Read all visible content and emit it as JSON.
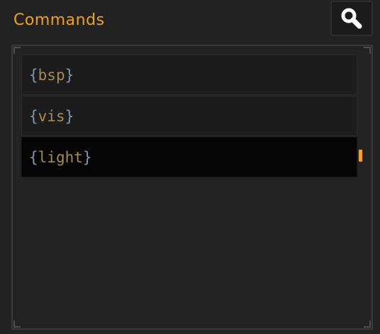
{
  "header": {
    "title": "Commands",
    "search_icon": "search-icon"
  },
  "commands": {
    "items": [
      {
        "open": "{",
        "name": "bsp",
        "close": "}"
      },
      {
        "open": "{",
        "name": "vis",
        "close": "}"
      },
      {
        "open": "{",
        "name": "light",
        "close": "}"
      }
    ],
    "selected_index": 2
  },
  "colors": {
    "accent": "#f2a21f",
    "brace": "#7f99b5",
    "command_text": "#a88a55",
    "icon": "#ffffff"
  }
}
